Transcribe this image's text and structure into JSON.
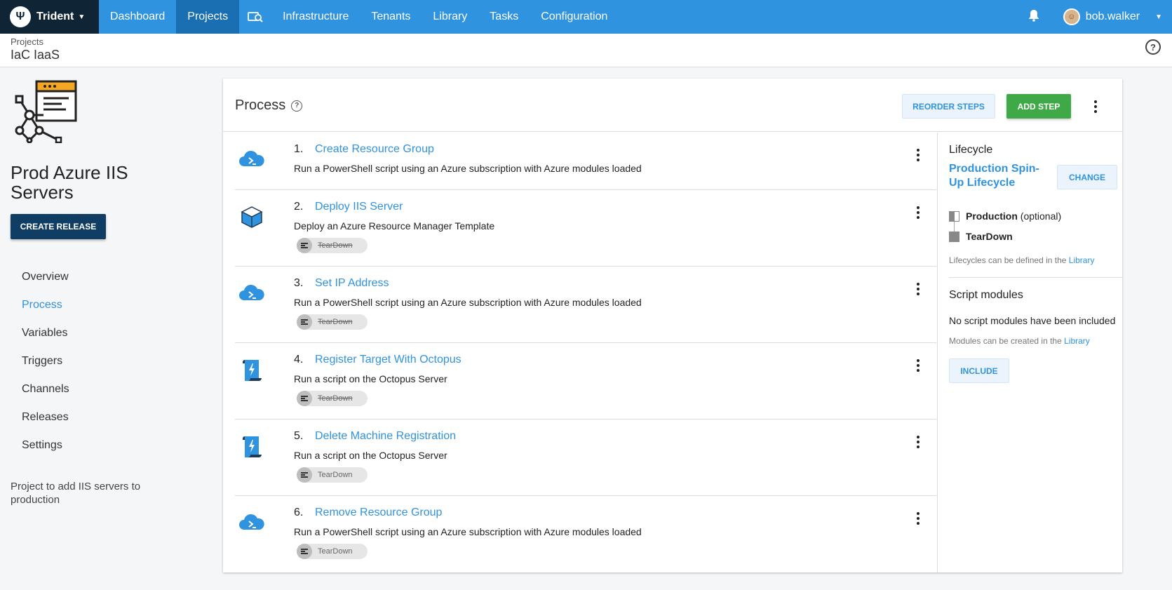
{
  "topnav": {
    "brand": "Trident",
    "items": [
      "Dashboard",
      "Projects",
      "Infrastructure",
      "Tenants",
      "Library",
      "Tasks",
      "Configuration"
    ],
    "active": "Projects",
    "username": "bob.walker",
    "accent_color": "#2f93e0",
    "brand_bg": "#0f2535"
  },
  "breadcrumb": {
    "parent": "Projects",
    "title": "IaC IaaS"
  },
  "project": {
    "name": "Prod Azure IIS Servers",
    "create_release": "CREATE RELEASE",
    "nav": [
      "Overview",
      "Process",
      "Variables",
      "Triggers",
      "Channels",
      "Releases",
      "Settings"
    ],
    "active_nav": "Process",
    "description": "Project to add IIS servers to production"
  },
  "process": {
    "title": "Process",
    "reorder_label": "REORDER STEPS",
    "add_label": "ADD STEP",
    "steps": [
      {
        "num": "1.",
        "name": "Create Resource Group",
        "description": "Run a PowerShell script using an Azure subscription with Azure modules loaded",
        "icon": "azure-cloud-powershell-icon"
      },
      {
        "num": "2.",
        "name": "Deploy IIS Server",
        "description": "Deploy an Azure Resource Manager Template",
        "icon": "azure-arm-cube-icon",
        "env": "TearDown",
        "env_excluded": true
      },
      {
        "num": "3.",
        "name": "Set IP Address",
        "description": "Run a PowerShell script using an Azure subscription with Azure modules loaded",
        "icon": "azure-cloud-powershell-icon",
        "env": "TearDown",
        "env_excluded": true
      },
      {
        "num": "4.",
        "name": "Register Target With Octopus",
        "description": "Run a script on the Octopus Server",
        "icon": "script-scroll-icon",
        "env": "TearDown",
        "env_excluded": true
      },
      {
        "num": "5.",
        "name": "Delete Machine Registration",
        "description": "Run a script on the Octopus Server",
        "icon": "script-scroll-icon",
        "env": "TearDown",
        "env_excluded": false
      },
      {
        "num": "6.",
        "name": "Remove Resource Group",
        "description": "Run a PowerShell script using an Azure subscription with Azure modules loaded",
        "icon": "azure-cloud-powershell-icon",
        "env": "TearDown",
        "env_excluded": false
      }
    ]
  },
  "lifecycle": {
    "heading": "Lifecycle",
    "name": "Production Spin-Up Lifecycle",
    "change_label": "CHANGE",
    "phases": [
      {
        "name": "Production",
        "suffix": "(optional)"
      },
      {
        "name": "TearDown",
        "suffix": ""
      }
    ],
    "note": "Lifecycles can be defined in the",
    "note_link": "Library"
  },
  "script_modules": {
    "heading": "Script modules",
    "empty_text": "No script modules have been included",
    "note": "Modules can be created in the",
    "note_link": "Library",
    "include_label": "INCLUDE"
  }
}
